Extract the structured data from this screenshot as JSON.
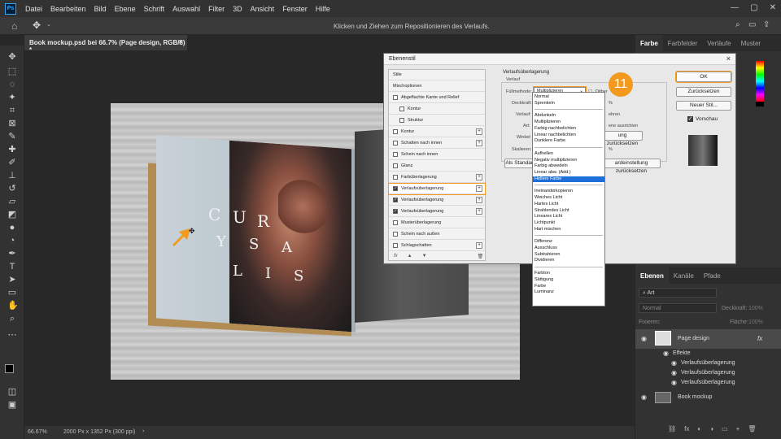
{
  "menubar": {
    "app_icon": "Ps",
    "items": [
      "Datei",
      "Bearbeiten",
      "Bild",
      "Ebene",
      "Schrift",
      "Auswahl",
      "Filter",
      "3D",
      "Ansicht",
      "Fenster",
      "Hilfe"
    ]
  },
  "optionsbar": {
    "hint": "Klicken und Ziehen zum Repositionieren des Verlaufs."
  },
  "document": {
    "tab_title": "Book mockup.psd bei 66.7% (Page design, RGB/8) *",
    "close": "×",
    "zoom": "66.67%",
    "dimensions": "2000 Px x 1352 Px (300 ppi)"
  },
  "book": {
    "title_letters": [
      "C",
      "U",
      "R",
      "Y",
      "S",
      "A",
      "L",
      "I",
      "S"
    ]
  },
  "dialog": {
    "title": "Ebenenstil",
    "close": "×",
    "styles": [
      {
        "label": "Stile",
        "checkbox": false,
        "checked": false,
        "plus": false,
        "indent": false
      },
      {
        "label": "Mischoptionen",
        "checkbox": false,
        "checked": false,
        "plus": false,
        "indent": false
      },
      {
        "label": "Abgeflachte Kante und Relief",
        "checkbox": true,
        "checked": false,
        "plus": false,
        "indent": false
      },
      {
        "label": "Kontur",
        "checkbox": true,
        "checked": false,
        "plus": false,
        "indent": true
      },
      {
        "label": "Struktur",
        "checkbox": true,
        "checked": false,
        "plus": false,
        "indent": true
      },
      {
        "label": "Kontur",
        "checkbox": true,
        "checked": false,
        "plus": true,
        "indent": false
      },
      {
        "label": "Schatten nach innen",
        "checkbox": true,
        "checked": false,
        "plus": true,
        "indent": false
      },
      {
        "label": "Schein nach innen",
        "checkbox": true,
        "checked": false,
        "plus": false,
        "indent": false
      },
      {
        "label": "Glanz",
        "checkbox": true,
        "checked": false,
        "plus": false,
        "indent": false
      },
      {
        "label": "Farbüberlagerung",
        "checkbox": true,
        "checked": false,
        "plus": true,
        "indent": false
      },
      {
        "label": "Verlaufsüberlagerung",
        "checkbox": true,
        "checked": true,
        "plus": true,
        "indent": false
      },
      {
        "label": "Verlaufsüberlagerung",
        "checkbox": true,
        "checked": true,
        "plus": true,
        "indent": false
      },
      {
        "label": "Verlaufsüberlagerung",
        "checkbox": true,
        "checked": true,
        "plus": true,
        "indent": false
      },
      {
        "label": "Musterüberlagerung",
        "checkbox": true,
        "checked": false,
        "plus": false,
        "indent": false
      },
      {
        "label": "Schein nach außen",
        "checkbox": true,
        "checked": false,
        "plus": false,
        "indent": false
      },
      {
        "label": "Schlagschatten",
        "checkbox": true,
        "checked": false,
        "plus": true,
        "indent": false
      }
    ],
    "footer_icons": [
      "fx",
      "▲",
      "▼",
      "🗑"
    ],
    "section_title": "Verlaufsüberlagerung",
    "section_sub": "Verlauf",
    "blend_label": "Füllmethode:",
    "blend_value": "Multiplizieren",
    "dither_label": "Dither",
    "opacity_label": "Deckkraft:",
    "opacity_unit": "%",
    "gradient_label": "Verlauf:",
    "reverse_label": "ehren",
    "style_label": "Art:",
    "align_label": "ene ausrichten",
    "angle_label": "Winkel:",
    "reset_align": "ung zurücksetzen",
    "scale_label": "Skalieren:",
    "scale_unit": "%",
    "default_btn": "Als Standard",
    "reset_default_btn": "ardeinstellung zurücksetzen",
    "ok": "OK",
    "reset": "Zurücksetzen",
    "new_style": "Neuer Stil...",
    "preview_label": "Vorschau",
    "step_badge": "11"
  },
  "blend_modes": {
    "groups": [
      [
        "Normal",
        "Sprenkeln"
      ],
      [
        "Abdunkeln",
        "Multiplizieren",
        "Farbig nachbelichten",
        "Linear nachbelichten",
        "Dunklere Farbe"
      ],
      [
        "Aufhellen",
        "Negativ multiplizieren",
        "Farbig abwedeln",
        "Linear abw. (Add.)",
        "Hellere Farbe"
      ],
      [
        "Ineinanderkopieren",
        "Weiches Licht",
        "Hartes Licht",
        "Strahlendes Licht",
        "Lineares Licht",
        "Lichtpunkt",
        "Hart mischen"
      ],
      [
        "Differenz",
        "Ausschluss",
        "Subtrahieren",
        "Dividieren"
      ],
      [
        "Farbton",
        "Sättigung",
        "Farbe",
        "Luminanz"
      ]
    ],
    "selected": "Hellere Farbe"
  },
  "color_panel": {
    "tabs": [
      "Farbe",
      "Farbfelder",
      "Verläufe",
      "Muster"
    ]
  },
  "layers_panel": {
    "tabs": [
      "Ebenen",
      "Kanäle",
      "Pfade"
    ],
    "search_placeholder": "Art",
    "blend_mode": "Normal",
    "opacity_label": "Deckkraft:",
    "opacity_value": "100%",
    "lock_label": "Fixieren:",
    "fill_label": "Fläche:",
    "fill_value": "100%",
    "layers": [
      {
        "name": "Page design",
        "fx": "fx"
      },
      {
        "name": "Book mockup",
        "fx": ""
      }
    ],
    "effects_label": "Effekte",
    "effects": [
      "Verlaufsüberlagerung",
      "Verlaufsüberlagerung",
      "Verlaufsüberlagerung"
    ],
    "footer_icons": [
      "⛓",
      "fx",
      "◐",
      "◑",
      "▭",
      "+",
      "🗑"
    ]
  },
  "colors": {
    "accent": "#f39a1e",
    "selection": "#1e6fd9",
    "panel_bg": "#323232",
    "workspace_bg": "#282828",
    "dialog_bg": "#e8e8e8"
  }
}
